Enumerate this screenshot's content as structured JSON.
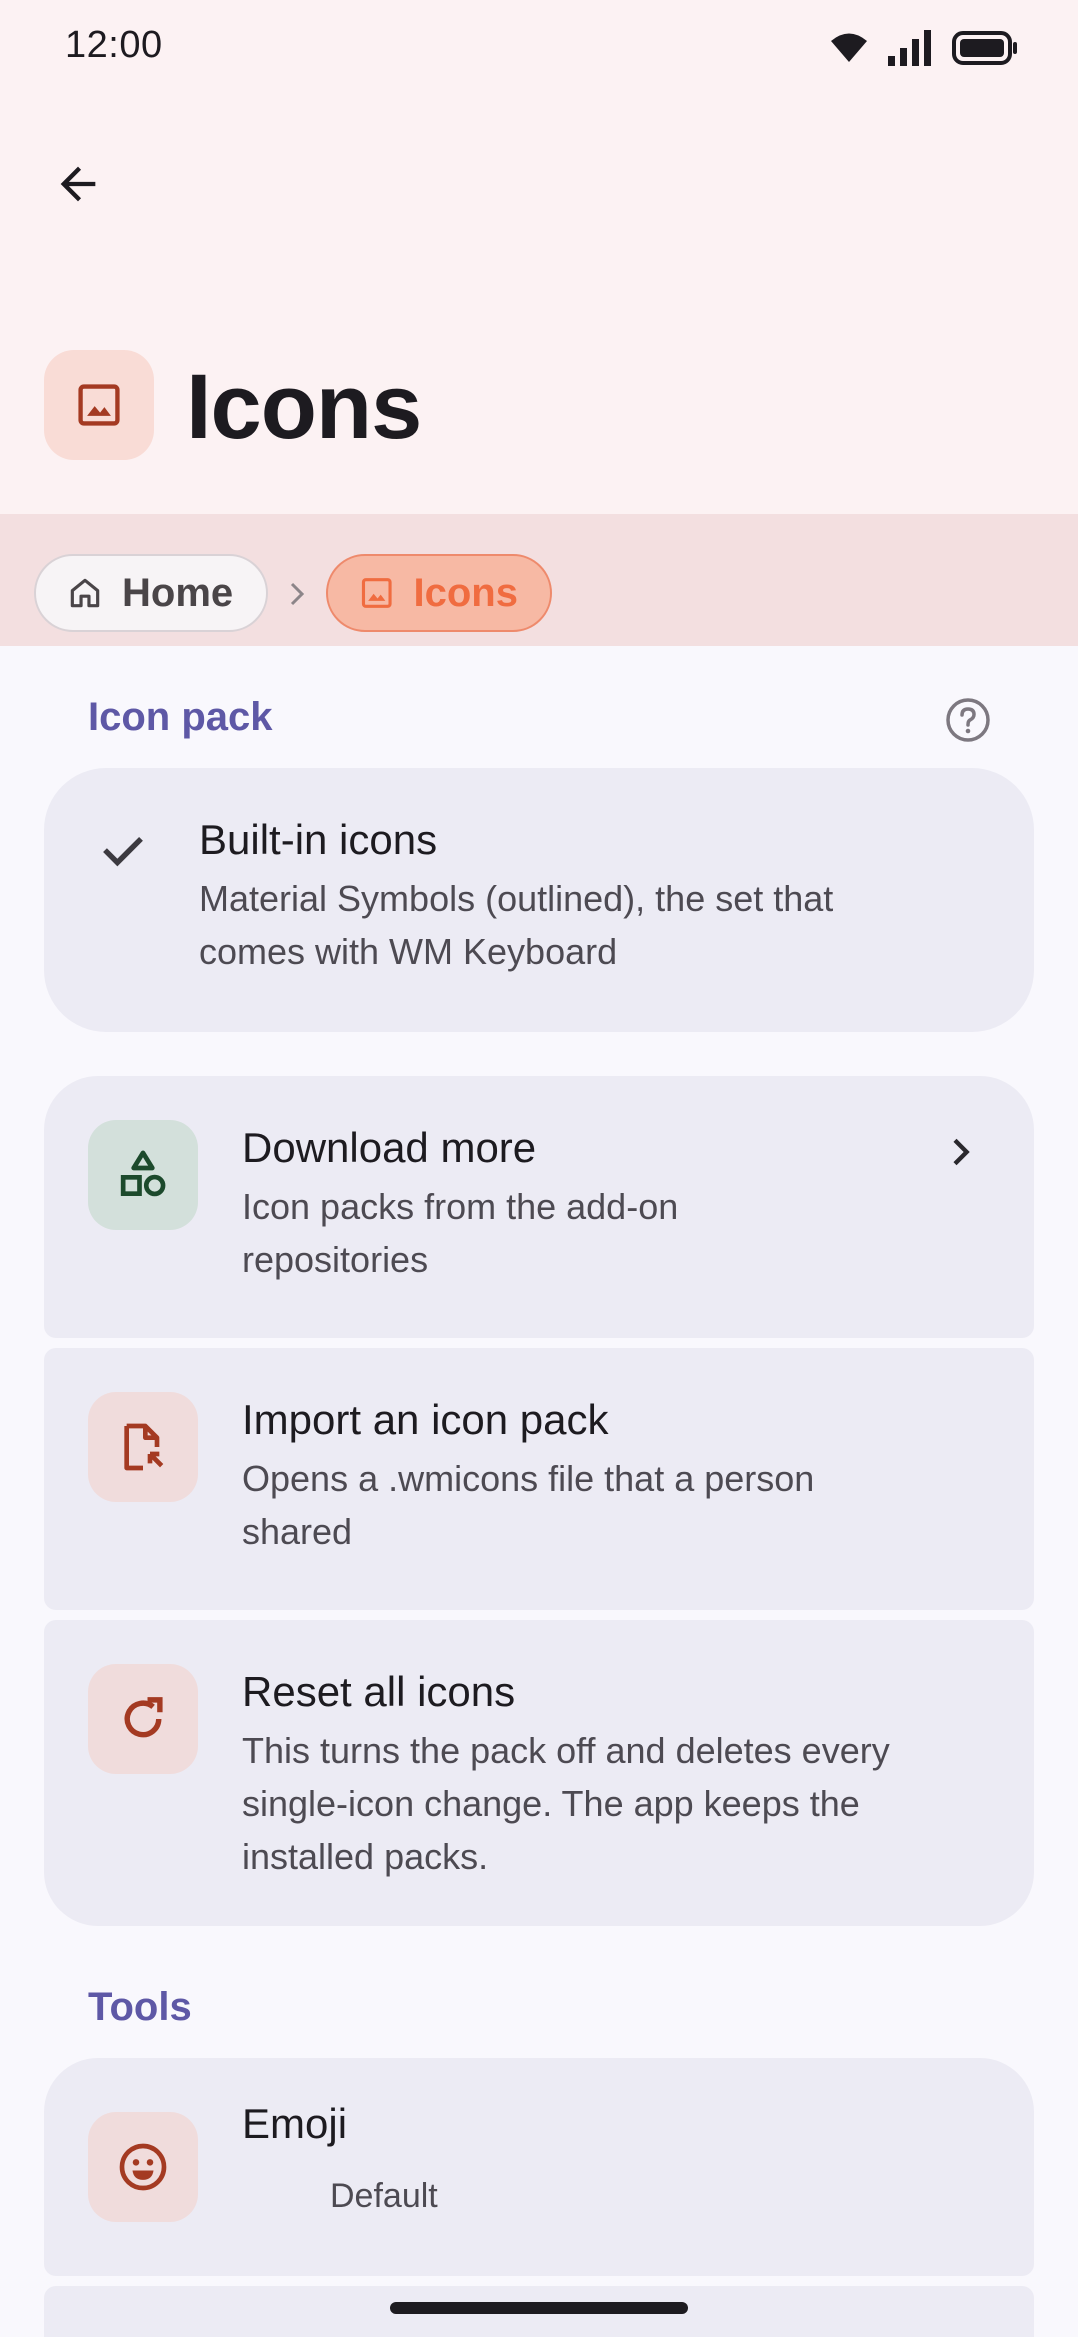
{
  "status_bar": {
    "time": "12:00"
  },
  "header": {
    "back_icon": "arrow-back-icon",
    "title": "Icons",
    "title_icon": "image-icon"
  },
  "breadcrumb": {
    "items": [
      {
        "label": "Home",
        "icon": "home-icon"
      },
      {
        "label": "Icons",
        "icon": "image-icon"
      }
    ]
  },
  "sections": {
    "icon_pack": {
      "title": "Icon pack",
      "help_icon": "help-icon"
    },
    "tools": {
      "title": "Tools"
    }
  },
  "icon_pack_items": {
    "builtin": {
      "title": "Built-in icons",
      "subtitle_line1": "Material Symbols (outlined), the set that",
      "subtitle_line2": "comes with WM Keyboard",
      "selected": true
    },
    "download": {
      "title": "Download more",
      "subtitle_line1": "Icon packs from the add-on",
      "subtitle_line2": "repositories"
    },
    "import": {
      "title": "Import an icon pack",
      "subtitle_line1": "Opens a .wmicons file that a person",
      "subtitle_line2": "shared"
    },
    "reset": {
      "title": "Reset all icons",
      "subtitle_line1": "This turns the pack off and deletes every",
      "subtitle_line2": "single-icon change. The app keeps the",
      "subtitle_line3": "installed packs."
    }
  },
  "tools_items": {
    "emoji": {
      "title": "Emoji",
      "value": "Default"
    }
  },
  "colors": {
    "accent": "#5e58a6",
    "header_bg": "#fcf2f3",
    "breadcrumb_bg": "#f3dfe0",
    "chip_active_bg": "#f7b9a4",
    "chip_active_text": "#f06c40",
    "card_bg": "#ecebf4",
    "icon_red": "#a43a22",
    "icon_green": "#1c4a2c"
  }
}
